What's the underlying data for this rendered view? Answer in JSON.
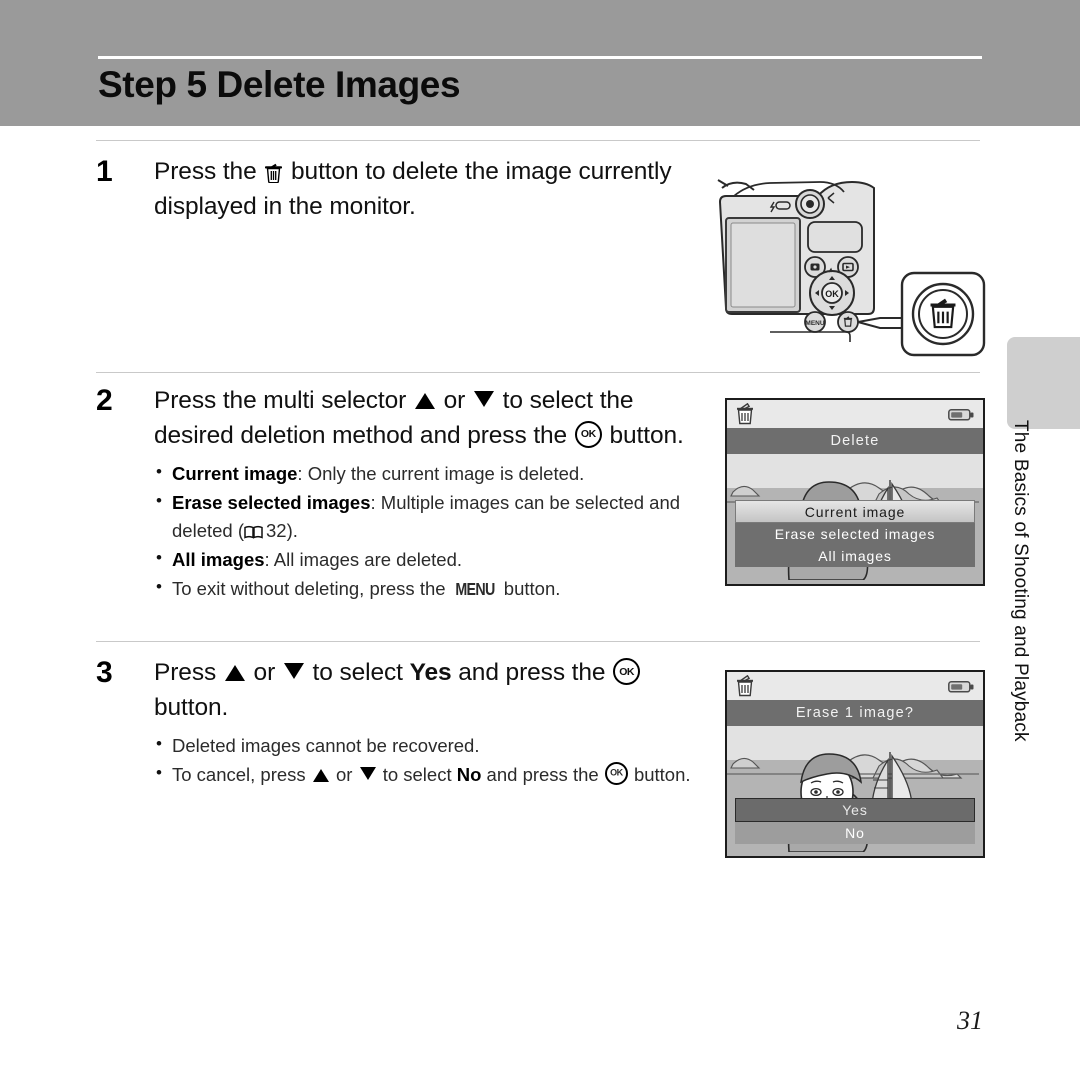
{
  "header": {
    "title": "Step 5 Delete Images"
  },
  "steps": [
    {
      "number": "1",
      "head_a": "Press the ",
      "head_b": " button to delete the image currently displayed in the monitor.",
      "bullets": []
    },
    {
      "number": "2",
      "head_a": "Press the multi selector ",
      "head_or": " or ",
      "head_b": " to select the desired deletion method and press the ",
      "head_c": " button.",
      "bullets": [
        {
          "bold": "Current image",
          "rest": ": Only the current image is deleted."
        },
        {
          "bold": "Erase selected images",
          "rest": ": Multiple images can be selected and deleted (",
          "page_ref": "32",
          "tail": ")."
        },
        {
          "bold": "All images",
          "rest": ": All images are deleted."
        },
        {
          "plain_a": "To exit without deleting, press the ",
          "menu": "MENU",
          "plain_b": " button."
        }
      ]
    },
    {
      "number": "3",
      "head_a": "Press ",
      "head_or": " or ",
      "head_b": " to select ",
      "head_bold": "Yes",
      "head_c": " and press the ",
      "head_d": " button.",
      "bullets": [
        {
          "plain": "Deleted images cannot be recovered."
        },
        {
          "plain_a": "To cancel, press ",
          "plain_b": " or ",
          "plain_c": " to select ",
          "bold": "No",
          "plain_d": " and press the ",
          "plain_e": " button."
        }
      ]
    }
  ],
  "monitors": [
    {
      "title": "Delete",
      "items": [
        {
          "label": "Current image",
          "selected": true
        },
        {
          "label": "Erase selected images",
          "selected": false
        },
        {
          "label": "All images",
          "selected": false
        }
      ]
    },
    {
      "title": "Erase 1 image?",
      "items": [
        {
          "label": "Yes",
          "selected": true
        },
        {
          "label": "No",
          "selected": false
        }
      ]
    }
  ],
  "side_tab": {
    "label": "The Basics of Shooting and Playback"
  },
  "page_number": "31",
  "colors": {
    "header_band": "#9a9a9a",
    "title_bar": "#6e6e6e",
    "side_tab": "#cfcfcf",
    "divider": "#c9c9c9"
  }
}
